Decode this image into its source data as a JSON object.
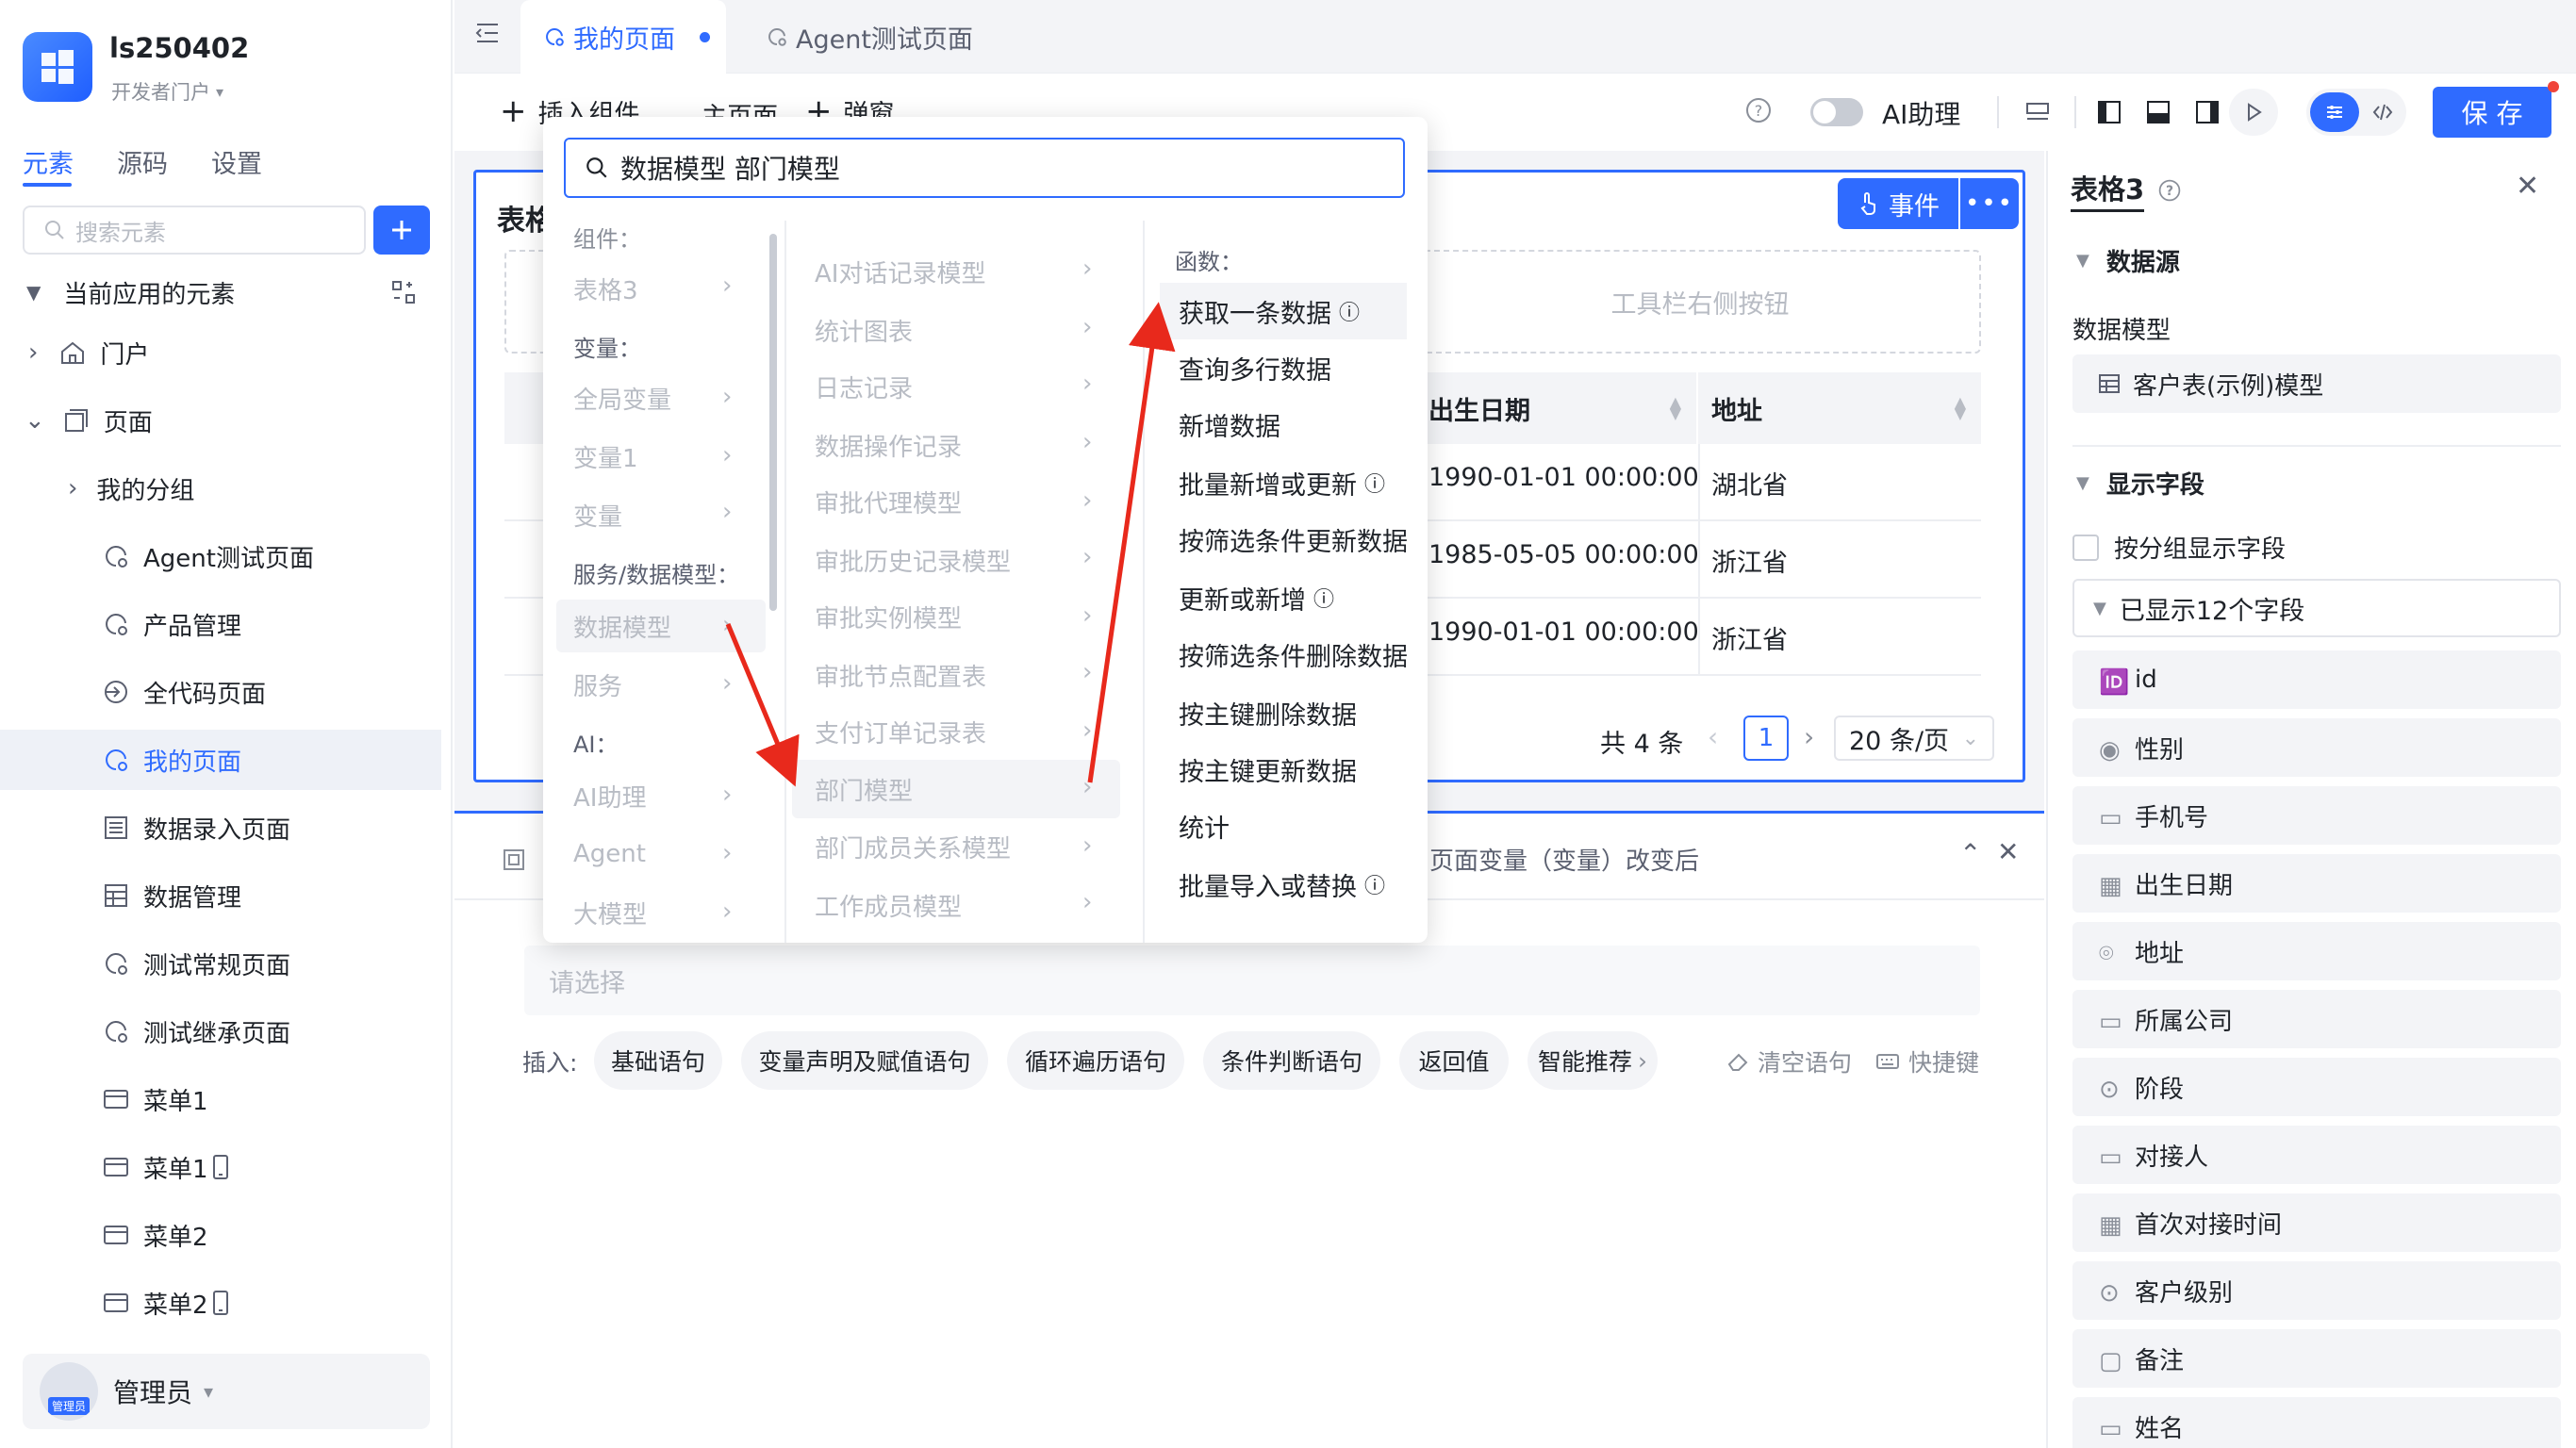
{
  "app": {
    "name": "ls250402",
    "portal": "开发者门户"
  },
  "sidebar": {
    "tabs": [
      "元素",
      "源码",
      "设置"
    ],
    "search_placeholder": "搜索元素",
    "section_title": "当前应用的元素",
    "items": [
      {
        "label": "门户"
      },
      {
        "label": "页面"
      },
      {
        "label": "我的分组"
      },
      {
        "label": "Agent测试页面"
      },
      {
        "label": "产品管理"
      },
      {
        "label": "全代码页面"
      },
      {
        "label": "我的页面"
      },
      {
        "label": "数据录入页面"
      },
      {
        "label": "数据管理"
      },
      {
        "label": "测试常规页面"
      },
      {
        "label": "测试继承页面"
      },
      {
        "label": "菜单1"
      },
      {
        "label": "菜单1"
      },
      {
        "label": "菜单2"
      },
      {
        "label": "菜单2"
      }
    ],
    "user": {
      "name": "管理员",
      "avatar_text": "管理员"
    }
  },
  "tabs": [
    {
      "label": "我的页面"
    },
    {
      "label": "Agent测试页面"
    }
  ],
  "toolbar": {
    "insert_label": "插入组件",
    "main_page_label": "主页面",
    "popup_label": "弹窗",
    "ai_label": "AI助理",
    "save_label": "保 存"
  },
  "canvas": {
    "table_title": "表格",
    "event_label": "事件",
    "toolbar_right_label": "工具栏右侧按钮",
    "columns": [
      "出生日期",
      "地址"
    ],
    "rows": [
      [
        "1990-01-01 00:00:00",
        "湖北省"
      ],
      [
        "1985-05-05 00:00:00",
        "浙江省"
      ],
      [
        "1990-01-01 00:00:00",
        "浙江省"
      ]
    ],
    "total": "共 4 条",
    "page": "1",
    "page_size": "20 条/页"
  },
  "dropdown": {
    "search_value": "数据模型 部门模型",
    "col1": {
      "groups": [
        {
          "header": "组件：",
          "items": [
            "表格3"
          ]
        },
        {
          "header": "变量：",
          "items": [
            "全局变量",
            "变量1",
            "变量"
          ]
        },
        {
          "header": "服务/数据模型：",
          "items": [
            "数据模型",
            "服务"
          ]
        },
        {
          "header": "AI：",
          "items": [
            "AI助理",
            "Agent",
            "大模型"
          ]
        }
      ]
    },
    "col2": {
      "items": [
        "AI对话记录模型",
        "统计图表",
        "日志记录",
        "数据操作记录",
        "审批代理模型",
        "审批历史记录模型",
        "审批实例模型",
        "审批节点配置表",
        "支付订单记录表",
        "部门模型",
        "部门成员关系模型",
        "工作成员模型"
      ]
    },
    "col3": {
      "header": "函数：",
      "items": [
        "获取一条数据",
        "查询多行数据",
        "新增数据",
        "批量新增或更新",
        "按筛选条件更新数据",
        "更新或新增",
        "按筛选条件删除数据",
        "按主键删除数据",
        "按主键更新数据",
        "统计",
        "批量导入或替换"
      ]
    }
  },
  "event_panel": {
    "title": "页面变量（变量）改变后",
    "select_placeholder": "请选择",
    "insert_label": "插入:",
    "pills": [
      "基础语句",
      "变量声明及赋值语句",
      "循环遍历语句",
      "条件判断语句",
      "返回值",
      "智能推荐"
    ],
    "clear_label": "清空语句",
    "shortcut_label": "快捷键"
  },
  "right_panel": {
    "title": "表格3",
    "datasource_label": "数据源",
    "datamodel_label": "数据模型",
    "datamodel_value": "客户表(示例)模型",
    "display_fields_label": "显示字段",
    "group_checkbox_label": "按分组显示字段",
    "shown_count_label": "已显示12个字段",
    "fields": [
      "id",
      "性别",
      "手机号",
      "出生日期",
      "地址",
      "所属公司",
      "阶段",
      "对接人",
      "首次对接时间",
      "客户级别",
      "备注",
      "姓名"
    ]
  },
  "colors": {
    "accent": "#2f6bff",
    "arrow": "#e8291c",
    "active_bg": "#eef1f7"
  }
}
